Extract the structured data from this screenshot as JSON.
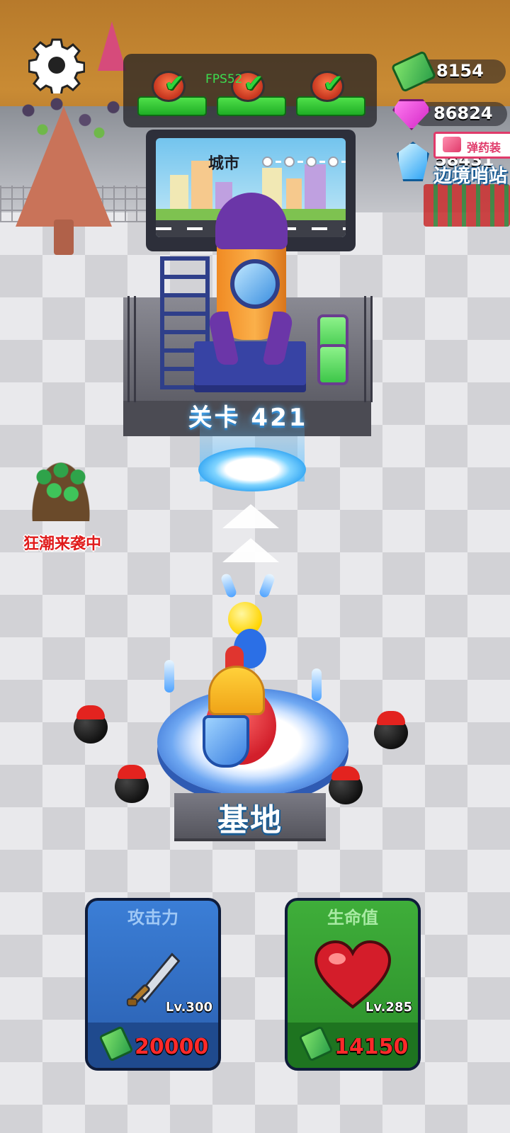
{
  "hud": {
    "fps": "FPS52",
    "currencies": [
      {
        "name": "cash",
        "value": "8154"
      },
      {
        "name": "gems",
        "value": "86824"
      },
      {
        "name": "crystals",
        "value": "58431"
      }
    ],
    "ammo_sign": "弹药装",
    "border_post": "边境哨站",
    "wave_alert": "狂潮来袭中"
  },
  "stage": {
    "billboard_title": "城市",
    "level_label": "关卡 421",
    "base_label": "基地"
  },
  "upgrades": [
    {
      "title": "攻击力",
      "level": "Lv.300",
      "cost": "20000",
      "icon": "sword-icon"
    },
    {
      "title": "生命值",
      "level": "Lv.285",
      "cost": "14150",
      "icon": "heart-icon"
    }
  ],
  "quests": [
    {
      "status": "complete",
      "icon": "check-icon"
    },
    {
      "status": "complete",
      "icon": "check-icon"
    },
    {
      "status": "complete",
      "icon": "check-icon"
    }
  ],
  "colors": {
    "attack_card": "#2a5fb0",
    "health_card": "#2a8d2a",
    "cost_text": "#ff2a2a",
    "wave_text": "#e01b1b",
    "quest_bar": "#1fae25"
  }
}
